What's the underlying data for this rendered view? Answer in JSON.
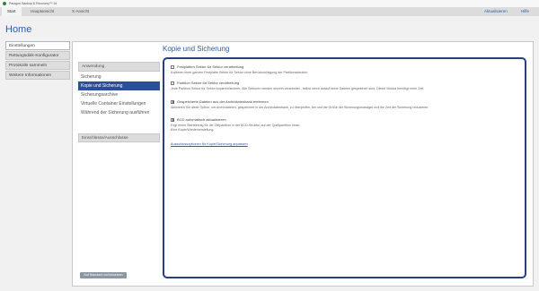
{
  "window": {
    "title": "Paragon Backup & Recovery™ 16"
  },
  "topbar": {
    "tabs": [
      "Start",
      "Hauptansicht",
      "X-Ansicht"
    ],
    "right_links": [
      "Aktualisieren",
      "Hilfe"
    ]
  },
  "page": {
    "title": "Home"
  },
  "leftnav": {
    "items": [
      "Einstellungen",
      "Rettungsdisk-Konfigurator",
      "Protokolle sammeln",
      "Weitere Informationen"
    ]
  },
  "main": {
    "title": "Kopie und Sicherung",
    "subnav_header": "Anwendung",
    "subnav_items": [
      "Sicherung",
      "Kopie und Sicherung",
      "Sicherungsarchive",
      "Virtuelle Container Einstellungen",
      "Während der Sicherung ausführen"
    ],
    "subnav_group2": "Einschlüsse/Ausschlüsse",
    "reset_button": "Auf Standard zurücksetzen"
  },
  "options": [
    {
      "label": "Festplatten Sektor für Sektor verarbeitung",
      "checked": false,
      "description": "Kopieren einer ganzen Festplatte Sektor für Sektor ohne Berücksichtigung der Partitionsstruktur."
    },
    {
      "label": "Partition Sektor für Sektor verarbeitung",
      "checked": false,
      "description": "Jede Partition Sektor für Sektor kopieren/sichern. Alle Sektoren werden einzeln verarbeitet - selbst wenn darauf keine Dateien gespeichert sind. Dieser Modus benötigt mehr Zeit."
    },
    {
      "label": "Gespeicherte Dateien aus der Archivdatenbank entfernen",
      "checked": true,
      "description": "Aktivieren Sie diese Option, um Archivdateien, gespeichert in der Archivdatenbank, zu überprüfen, bei und die Größe der Sicherungsmanager und die Zeit der Sicherung reduzieren."
    },
    {
      "label": "BCD automatisch aktualisieren",
      "checked": true,
      "description": "Fügt einen Starteintrag für die Zielpartition in der BCD-Struktur auf der Quellpartition hinzu. Eine Kopie/Wiederherstellung."
    }
  ],
  "advanced_link": "Ausschlussoptionen für Kopie/Sicherung anpassen"
}
